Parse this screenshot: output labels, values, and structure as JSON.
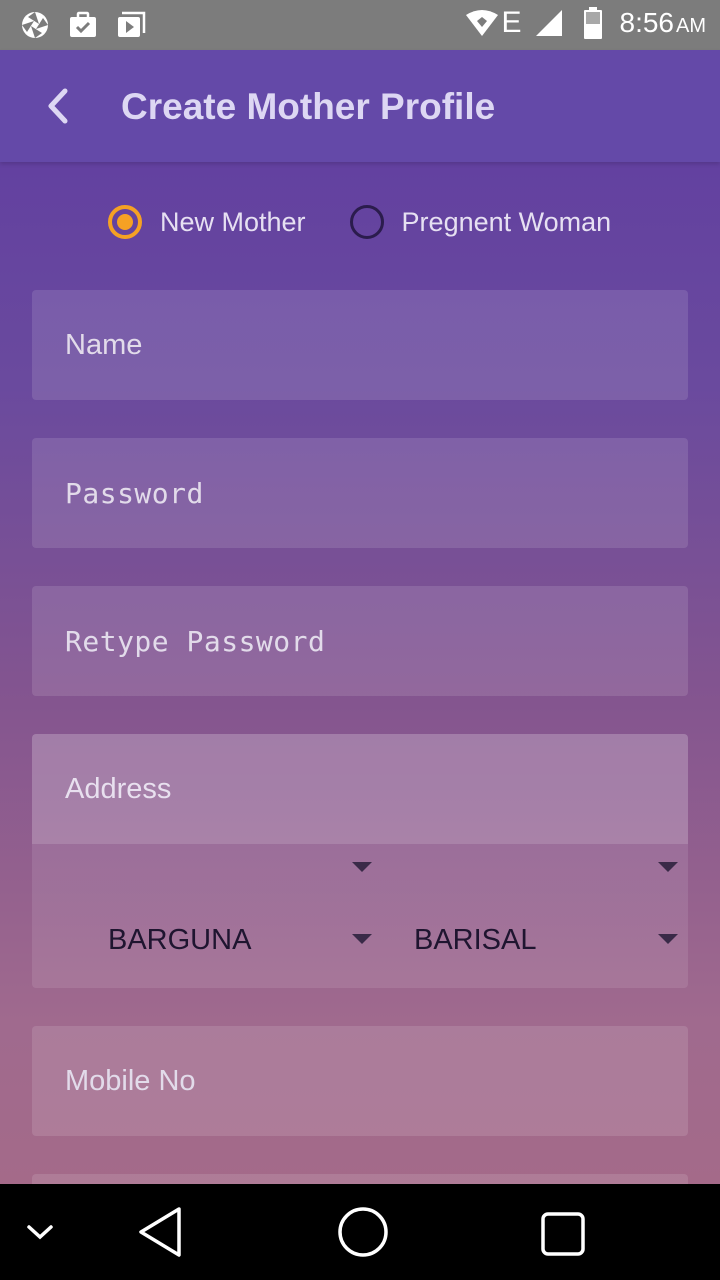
{
  "status_bar": {
    "time": "8:56",
    "ampm": "AM",
    "network_label": "E"
  },
  "toolbar": {
    "title": "Create Mother Profile"
  },
  "profile_type": {
    "options": [
      {
        "label": "New Mother",
        "selected": true
      },
      {
        "label": "Pregnent Woman",
        "selected": false
      }
    ]
  },
  "form": {
    "name_placeholder": "Name",
    "password_placeholder": "Password",
    "retype_password_placeholder": "Retype Password",
    "address_placeholder": "Address",
    "district_top_value": "",
    "division_top_value": "",
    "district_value": "BARGUNA",
    "division_value": "BARISAL",
    "mobile_placeholder": "Mobile No"
  },
  "colors": {
    "accent": "#f5a124",
    "toolbar": "#6449a8",
    "status_bar": "#7c7c7c"
  }
}
